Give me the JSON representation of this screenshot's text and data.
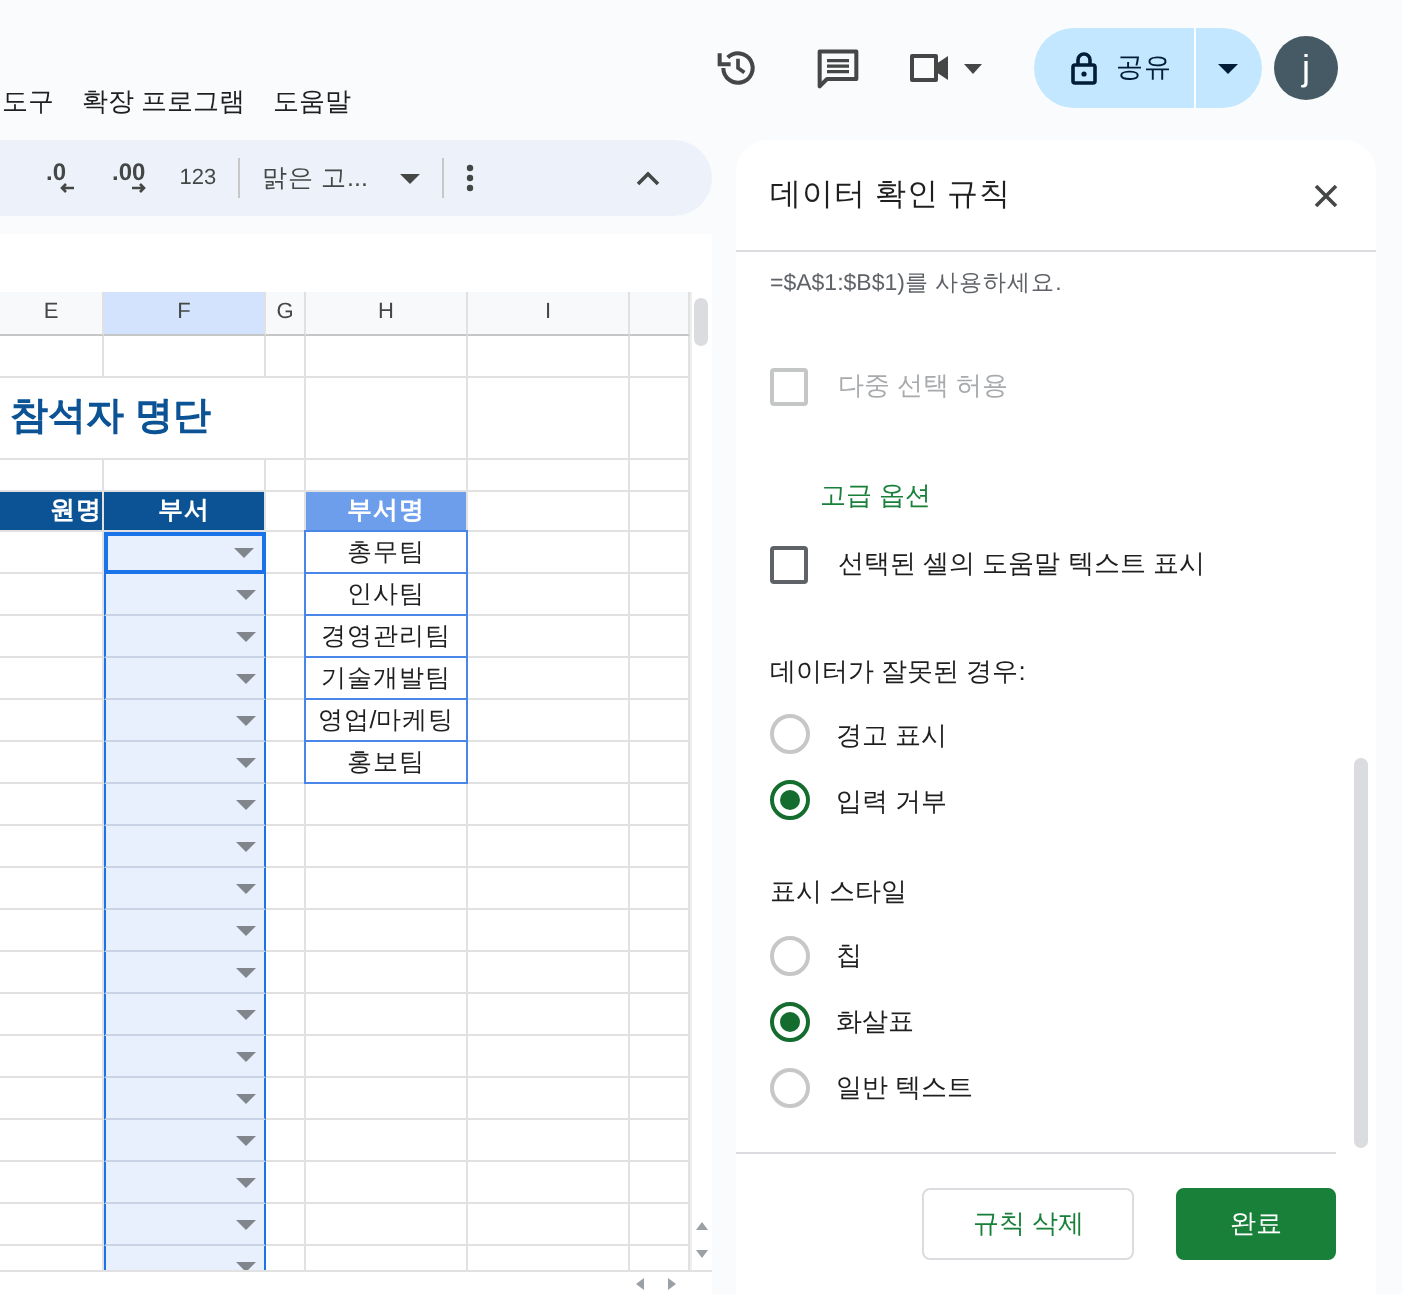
{
  "menu": [
    "도구",
    "확장 프로그램",
    "도움말"
  ],
  "toolbar": {
    "decrease_decimal": ".0",
    "increase_decimal": ".00",
    "number_format": "123",
    "font": "맑은 고..."
  },
  "share": {
    "label": "공유"
  },
  "avatar": "j",
  "sheet": {
    "columns": [
      {
        "label": "E",
        "selected": false
      },
      {
        "label": "F",
        "selected": true
      },
      {
        "label": "G",
        "selected": false
      },
      {
        "label": "H",
        "selected": false
      },
      {
        "label": "I",
        "selected": false
      }
    ],
    "title": "참석자 명단",
    "headers": [
      "원명",
      "부서"
    ],
    "lookup_header": "부서명",
    "departments": [
      "총무팀",
      "인사팀",
      "경영관리팀",
      "기술개발팀",
      "영업/마케팅",
      "홍보팀"
    ],
    "dropdown_cells": [
      {
        "selected": true
      },
      {
        "selected": false
      },
      {
        "selected": false
      },
      {
        "selected": false
      },
      {
        "selected": false
      },
      {
        "selected": false
      },
      {
        "selected": false
      },
      {
        "selected": false
      },
      {
        "selected": false
      },
      {
        "selected": false
      },
      {
        "selected": false
      },
      {
        "selected": false
      },
      {
        "selected": false
      },
      {
        "selected": false
      },
      {
        "selected": false
      },
      {
        "selected": false
      },
      {
        "selected": false
      },
      {
        "selected": false
      }
    ]
  },
  "panel": {
    "title": "데이터 확인 규칙",
    "help_text": "=$A$1:$B$1)를 사용하세요.",
    "multi_select": {
      "label": "다중 선택 허용",
      "checked": false,
      "disabled": true
    },
    "advanced_link": "고급 옵션",
    "show_help": {
      "label": "선택된 셀의 도움말 텍스트 표시",
      "checked": false,
      "disabled": false
    },
    "invalid_data": {
      "heading": "데이터가 잘못된 경우:",
      "options": [
        {
          "label": "경고 표시",
          "selected": false
        },
        {
          "label": "입력 거부",
          "selected": true
        }
      ]
    },
    "display_style": {
      "heading": "표시 스타일",
      "options": [
        {
          "label": "칩",
          "selected": false
        },
        {
          "label": "화살표",
          "selected": true
        },
        {
          "label": "일반 텍스트",
          "selected": false
        }
      ]
    },
    "buttons": [
      {
        "label": "규칙 삭제",
        "kind": "secondary"
      },
      {
        "label": "완료",
        "kind": "primary"
      }
    ]
  }
}
